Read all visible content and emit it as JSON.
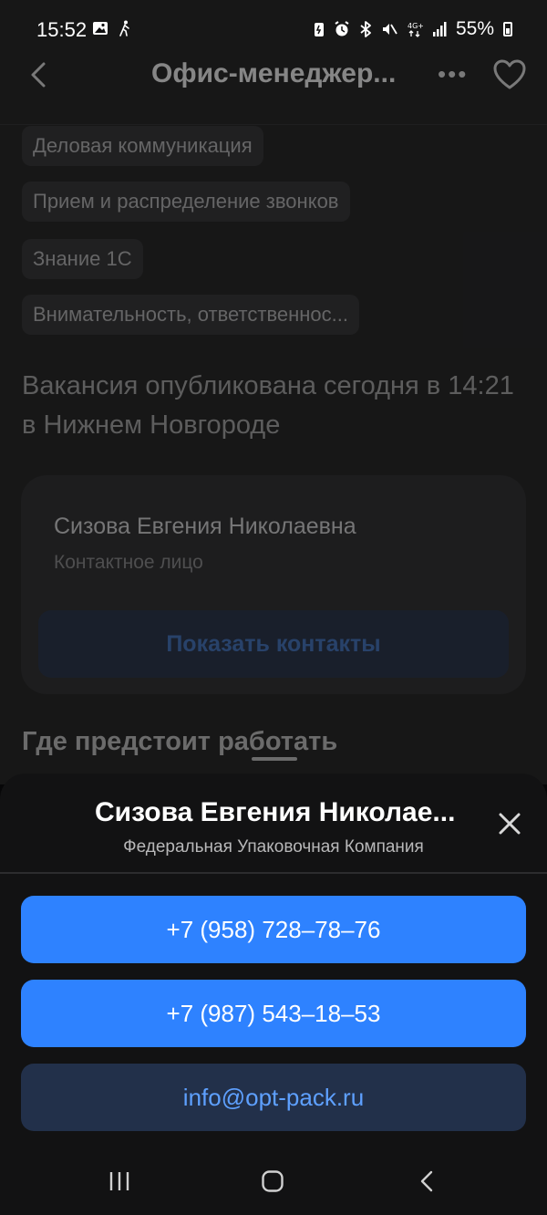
{
  "status_bar": {
    "time": "15:52",
    "battery": "55%",
    "icons": [
      "image-icon",
      "walking-icon",
      "battery-saver-icon",
      "alarm-icon",
      "bluetooth-icon",
      "mute-icon",
      "4g-icon",
      "signal-icon"
    ]
  },
  "header": {
    "title": "Офис-менеджер...",
    "back_icon": "chevron-left-icon",
    "more_icon": "more-icon",
    "favorite_icon": "heart-icon"
  },
  "skills": [
    "Деловая коммуникация",
    "Прием и распределение звонков",
    "Знание 1С",
    "Внимательность, ответственнос..."
  ],
  "published": "Вакансия опубликована сегодня в 14:21 в Нижнем Новгороде",
  "contact_card": {
    "name": "Сизова Евгения Николаевна",
    "role": "Контактное лицо",
    "show_contacts_label": "Показать контакты"
  },
  "where_heading": "Где предстоит работать",
  "sheet": {
    "title": "Сизова Евгения Николае...",
    "subtitle": "Федеральная Упаковочная Компания",
    "phones": [
      "+7 (958) 728–78–76",
      "+7 (987) 543–18–53"
    ],
    "email": "info@opt-pack.ru"
  },
  "colors": {
    "accent": "#2e82ff",
    "email_bg": "#22304a",
    "sheet_bg": "#121213"
  }
}
